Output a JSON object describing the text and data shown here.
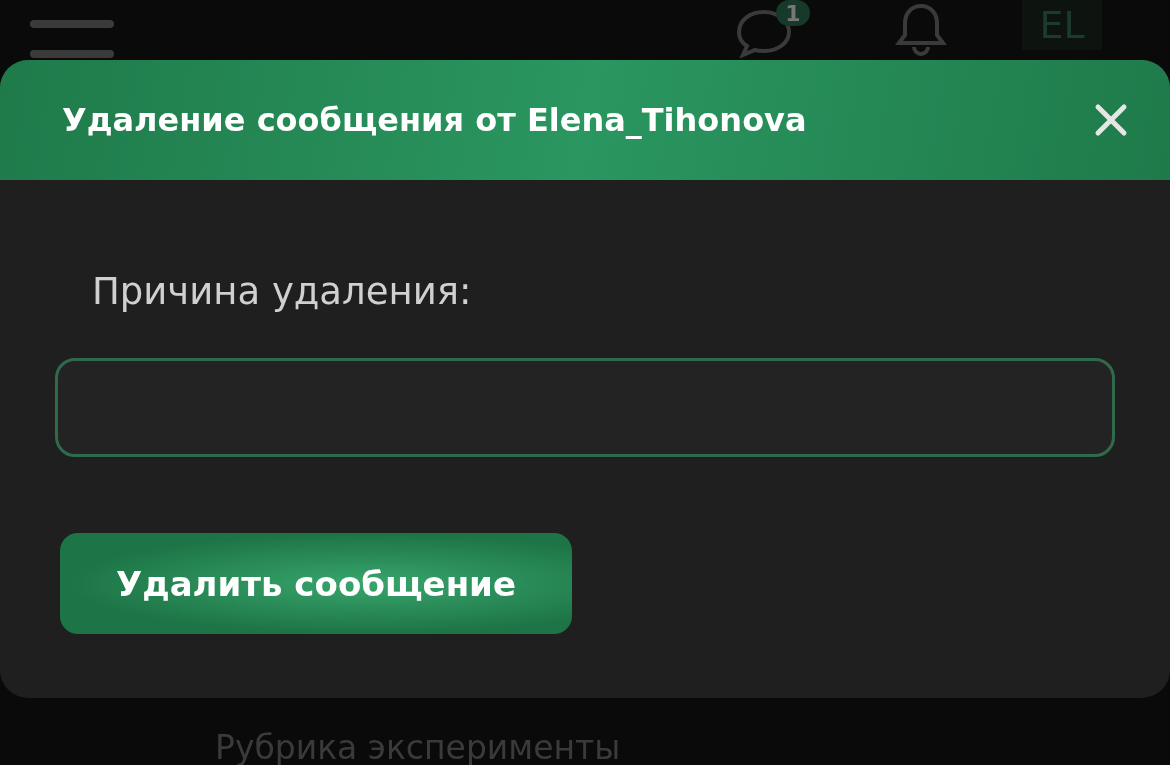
{
  "top_bar": {
    "chat_badge": "1",
    "avatar": "EL"
  },
  "background_heading": "Рубрика эксперименты",
  "dialog": {
    "title": "Удаление сообщения от Elena_Tihonova",
    "field_label": "Причина удаления:",
    "submit_button": "Удалить сообщение"
  }
}
